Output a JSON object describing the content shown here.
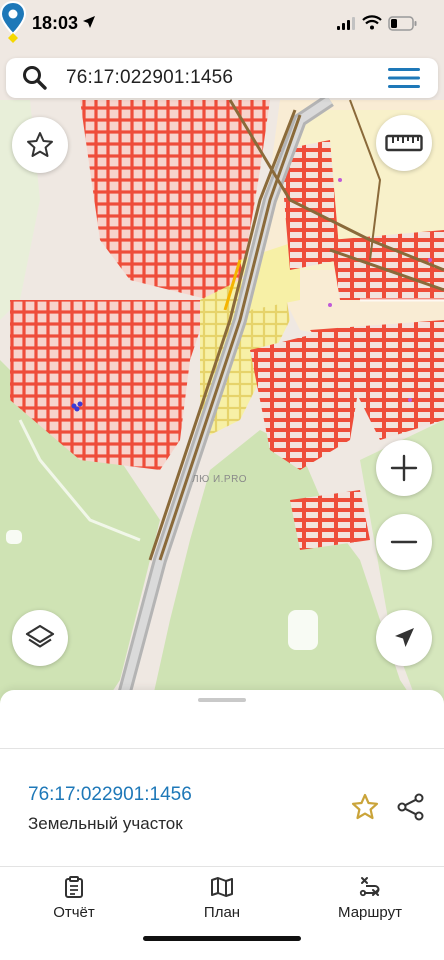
{
  "status_bar": {
    "time": "18:03"
  },
  "search": {
    "value": "76:17:022901:1456"
  },
  "map": {
    "watermark": "ЛЮ И.PRO",
    "colors": {
      "forest": "#cfe3b4",
      "parcel_fill": "#f7d4cc",
      "parcel_border": "#ee4d3a",
      "zone_yellow": "#f7f0a6",
      "road_brown": "#8a6a3a"
    }
  },
  "controls": {
    "favorite": "star-icon",
    "ruler": "ruler-icon",
    "zoom_in": "plus-icon",
    "zoom_out": "minus-icon",
    "layers": "layers-icon",
    "location": "navigation-arrow-icon"
  },
  "parcel": {
    "cadastral_number": "76:17:022901:1456",
    "type": "Земельный участок",
    "accent_color": "#1e78b8",
    "star_color": "#caa43a"
  },
  "tabs": [
    {
      "label": "Отчёт",
      "icon": "clipboard-icon"
    },
    {
      "label": "План",
      "icon": "map-icon"
    },
    {
      "label": "Маршрут",
      "icon": "route-icon"
    }
  ]
}
